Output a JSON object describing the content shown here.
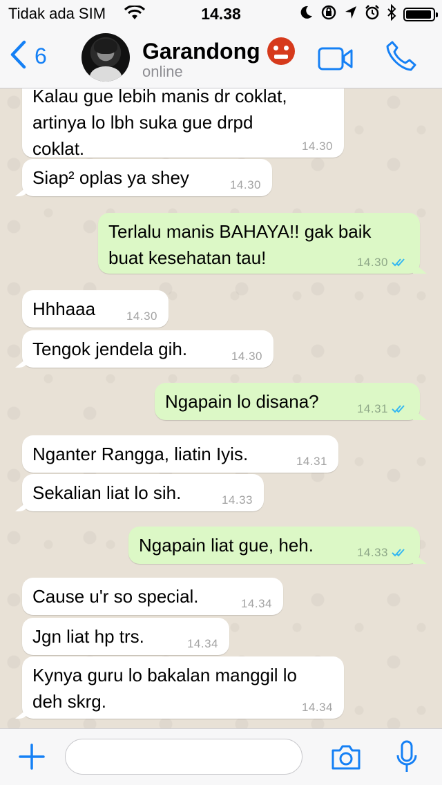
{
  "status_bar": {
    "carrier": "Tidak ada SIM",
    "time": "14.38",
    "battery_level": 0.95
  },
  "header": {
    "back_count": "6",
    "contact_name": "Garandong",
    "contact_status": "online"
  },
  "messages": [
    {
      "direction": "in",
      "text": "Kalau gue lebih manis dr coklat,\nartinya lo lbh suka gue drpd\ncoklat.",
      "time": "14.30",
      "tail": false
    },
    {
      "direction": "in",
      "text": "Siap² oplas ya shey",
      "time": "14.30",
      "tail": true
    },
    {
      "direction": "out",
      "text": "Terlalu manis BAHAYA!! gak baik\nbuat kesehatan tau!",
      "time": "14.30",
      "read": true,
      "tail": true
    },
    {
      "direction": "in",
      "text": "Hhhaaa",
      "time": "14.30",
      "tail": false
    },
    {
      "direction": "in",
      "text": "Tengok jendela gih.",
      "time": "14.30",
      "tail": true
    },
    {
      "direction": "out",
      "text": "Ngapain lo disana?",
      "time": "14.31",
      "read": true,
      "tail": true
    },
    {
      "direction": "in",
      "text": "Nganter Rangga, liatin Iyis.",
      "time": "14.31",
      "tail": false
    },
    {
      "direction": "in",
      "text": "Sekalian liat lo sih.",
      "time": "14.33",
      "tail": true
    },
    {
      "direction": "out",
      "text": "Ngapain liat gue, heh.",
      "time": "14.33",
      "read": true,
      "tail": true
    },
    {
      "direction": "in",
      "text": "Cause u'r so special.",
      "time": "14.34",
      "tail": false
    },
    {
      "direction": "in",
      "text": "Jgn liat hp trs.",
      "time": "14.34",
      "tail": false
    },
    {
      "direction": "in",
      "text": "Kynya guru lo bakalan manggil lo\ndeh skrg.",
      "time": "14.34",
      "tail": true
    }
  ],
  "input_bar": {
    "placeholder": ""
  },
  "colors": {
    "accent": "#1580f5",
    "incoming_bubble": "#ffffff",
    "outgoing_bubble": "#dcf8c6",
    "read_ticks": "#34b7f1",
    "chat_background": "#e8e1d6"
  }
}
